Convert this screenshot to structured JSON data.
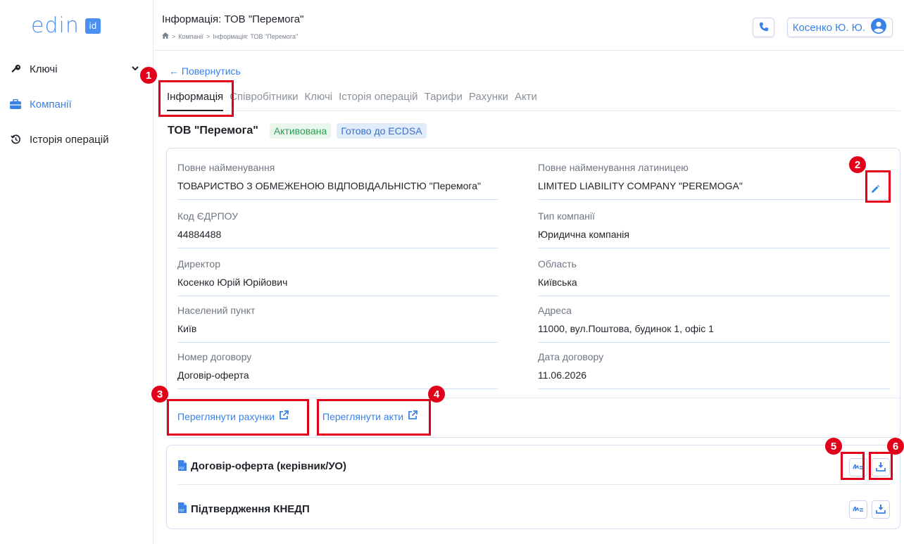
{
  "logo": {
    "text": "edin",
    "badge": "id"
  },
  "sidebar": {
    "items": [
      {
        "label": "Ключі",
        "icon": "key-icon"
      },
      {
        "label": "Компанії",
        "icon": "briefcase-icon"
      },
      {
        "label": "Історія операцій",
        "icon": "history-icon"
      }
    ]
  },
  "header": {
    "title": "Інформація: ТОВ \"Перемога\"",
    "breadcrumb": [
      "Компанії",
      "Інформація: ТОВ \"Перемога\""
    ],
    "user": "Косенко Ю. Ю."
  },
  "back": "← Повернутись",
  "tabs": [
    "Інформація",
    "Співробітники",
    "Ключі",
    "Історія операцій",
    "Тарифи",
    "Рахунки",
    "Акти"
  ],
  "company": {
    "name": "ТОВ \"Перемога\"",
    "status": "Активована",
    "ecdsa": "Готово до ECDSA"
  },
  "fields": {
    "full_name": {
      "label": "Повне найменування",
      "value": "ТОВАРИСТВО З ОБМЕЖЕНОЮ ВІДПОВІДАЛЬНІСТЮ \"Перемога\""
    },
    "full_name_latin": {
      "label": "Повне найменування латиницею",
      "value": "LIMITED LIABILITY COMPANY \"PEREMOGA\""
    },
    "edrpou": {
      "label": "Код ЄДРПОУ",
      "value": "44884488"
    },
    "company_type": {
      "label": "Тип компанії",
      "value": "Юридична компанія"
    },
    "director": {
      "label": "Директор",
      "value": "Косенко Юрій Юрійович"
    },
    "region": {
      "label": "Область",
      "value": "Київська"
    },
    "city": {
      "label": "Населений пункт",
      "value": "Київ"
    },
    "address": {
      "label": "Адреса",
      "value": "11000, вул.Поштова, будинок 1, офіс 1"
    },
    "contract_number": {
      "label": "Номер договору",
      "value": "Договір-оферта"
    },
    "contract_date": {
      "label": "Дата договору",
      "value": "11.06.2026"
    }
  },
  "links": {
    "invoices": "Переглянути рахунки",
    "acts": "Переглянути акти"
  },
  "documents": [
    {
      "title": "Договір-оферта (керівник/УО)"
    },
    {
      "title": "Підтвердження КНЕДП"
    }
  ],
  "annotations": [
    "1",
    "2",
    "3",
    "4",
    "5",
    "6"
  ],
  "colors": {
    "accent": "#3b82e6",
    "annotation": "#e3001b",
    "success": "#2f9e55"
  }
}
